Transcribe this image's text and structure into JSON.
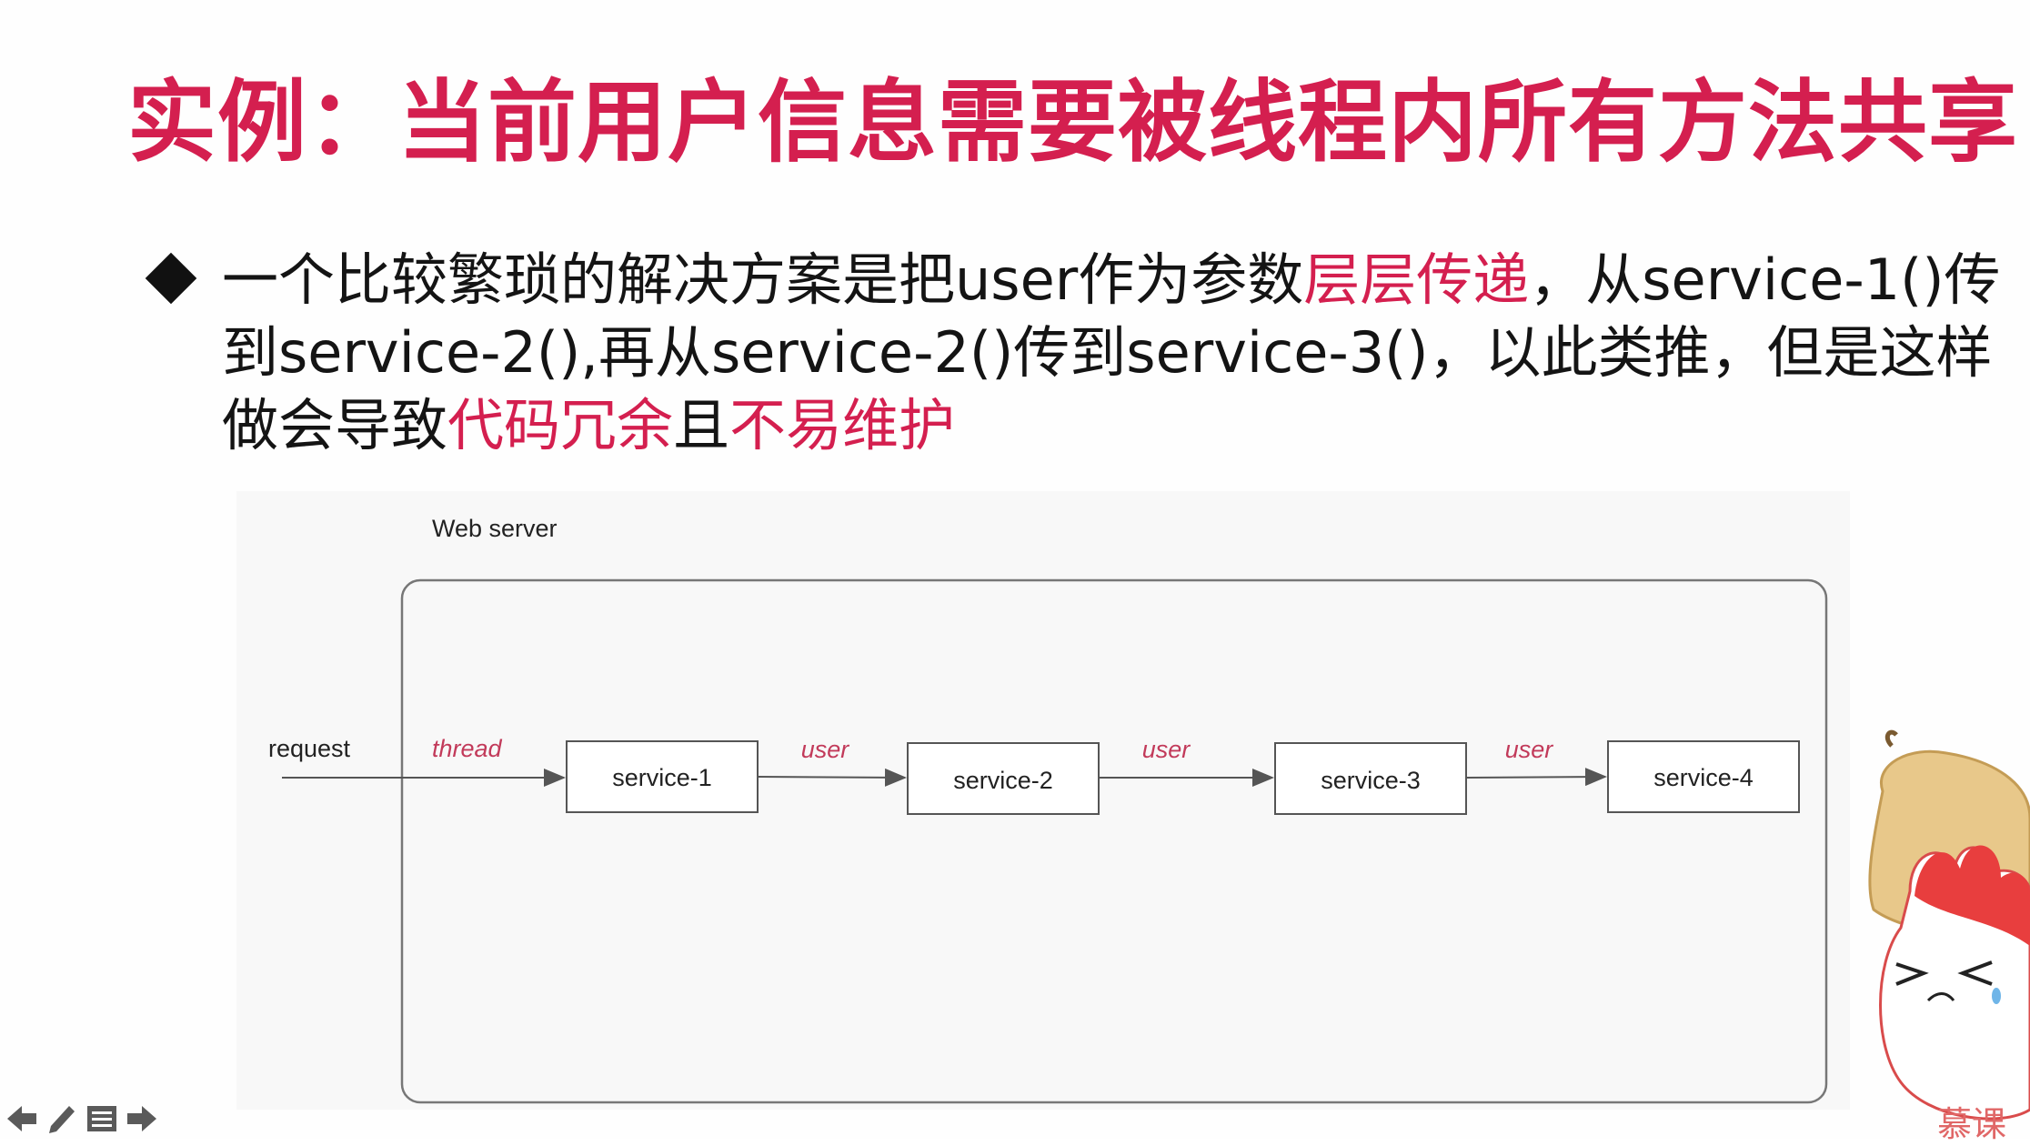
{
  "slide": {
    "title": "实例：当前用户信息需要被线程内所有方法共享",
    "bullet": {
      "segments": [
        {
          "text": "一个比较繁琐的解决方案是把user作为参数",
          "highlight": false
        },
        {
          "text": "层层传递",
          "highlight": true
        },
        {
          "text": "，从service-1()传到service-2(),再从service-2()传到service-3()，以此类推，但是这样做会导致",
          "highlight": false
        },
        {
          "text": "代码冗余",
          "highlight": true
        },
        {
          "text": "且",
          "highlight": false
        },
        {
          "text": "不易维护",
          "highlight": true
        }
      ]
    }
  },
  "diagram": {
    "container_label": "Web server",
    "request_label": "request",
    "thread_label": "thread",
    "services": [
      "service-1",
      "service-2",
      "service-3",
      "service-4"
    ],
    "edge_labels": [
      "user",
      "user",
      "user"
    ]
  },
  "toolbar": {
    "icons": [
      "arrow-left-icon",
      "pencil-icon",
      "menu-icon",
      "arrow-right-icon"
    ]
  },
  "brand": {
    "text": "慕课"
  },
  "colors": {
    "accent": "#d41f4f",
    "diagram_label": "#c23a5a",
    "text": "#141414"
  }
}
